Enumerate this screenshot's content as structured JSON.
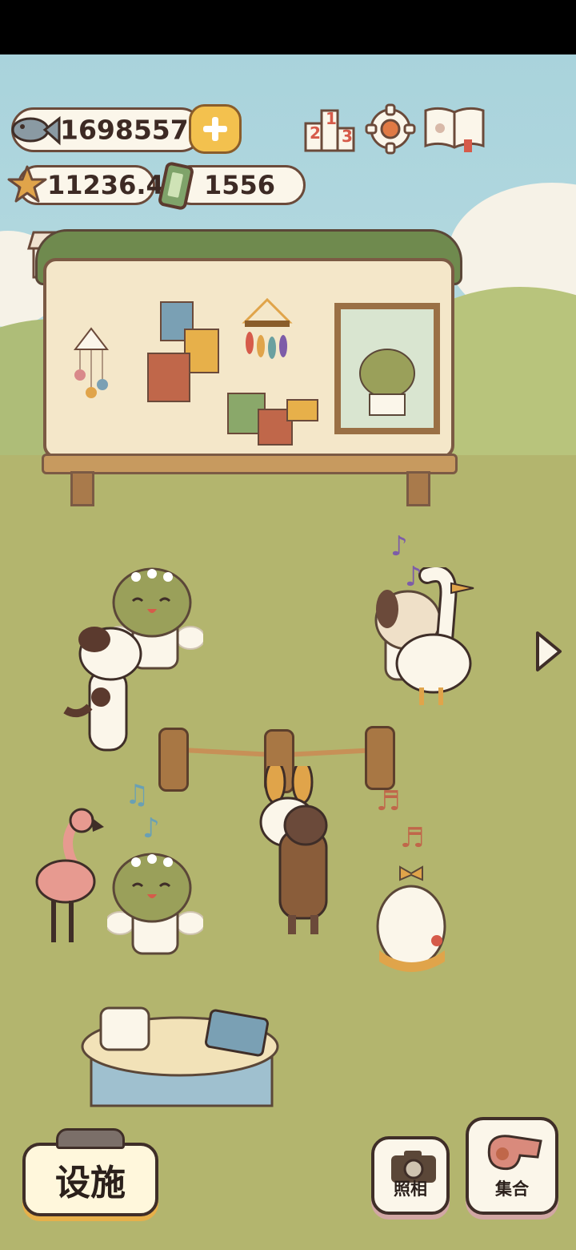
{
  "hud": {
    "fish_count": "1698557",
    "star_count": "11236.4",
    "ticket_count": "1556",
    "icons": [
      "fish-icon",
      "plus-icon",
      "leaderboard-icon",
      "gear-icon",
      "journal-book-icon",
      "star-icon",
      "ticket-icon",
      "shop-icon"
    ]
  },
  "buttons": {
    "facility_label": "设施",
    "photo_label": "照相",
    "gather_label": "集合"
  },
  "leaderboard": {
    "digits": [
      "2",
      "1",
      "3"
    ]
  },
  "colors": {
    "sky": "#a9d3dc",
    "grass": "#b3b56e",
    "outline": "#3f2e28",
    "accent_yellow": "#f3c14e"
  }
}
